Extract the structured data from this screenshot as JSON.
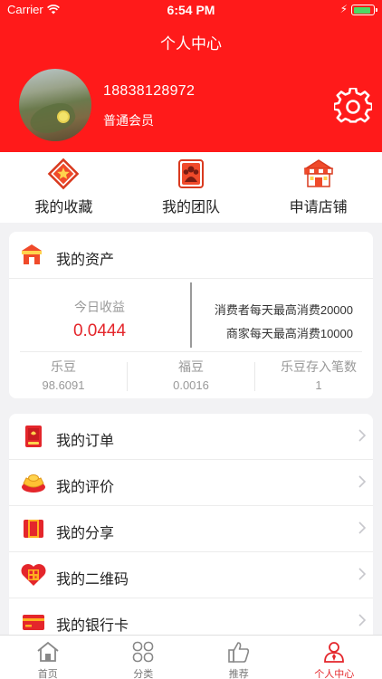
{
  "status_bar": {
    "carrier": "Carrier",
    "time": "6:54 PM",
    "battery_level": 0.9
  },
  "header": {
    "title": "个人中心",
    "phone": "18838128972",
    "member_level": "普通会员"
  },
  "quick_actions": [
    {
      "label": "我的收藏",
      "icon": "favorites-star-icon"
    },
    {
      "label": "我的团队",
      "icon": "team-icon"
    },
    {
      "label": "申请店铺",
      "icon": "shop-icon"
    }
  ],
  "assets": {
    "title": "我的资产",
    "icon": "shop-small-icon",
    "today_income_label": "今日收益",
    "today_income_value": "0.0444",
    "consumer_limit": "消费者每天最高消费20000",
    "merchant_limit": "商家每天最高消费10000",
    "stats": [
      {
        "label": "乐豆",
        "value": "98.6091"
      },
      {
        "label": "福豆",
        "value": "0.0016"
      },
      {
        "label": "乐豆存入笔数",
        "value": "1"
      }
    ]
  },
  "menu": [
    {
      "label": "我的订单",
      "icon": "order-book-icon"
    },
    {
      "label": "我的评价",
      "icon": "gold-ingot-icon"
    },
    {
      "label": "我的分享",
      "icon": "share-envelope-icon"
    },
    {
      "label": "我的二维码",
      "icon": "qr-code-heart-icon"
    },
    {
      "label": "我的银行卡",
      "icon": "bank-card-icon"
    }
  ],
  "tabbar": [
    {
      "label": "首页",
      "icon": "home-icon",
      "active": false
    },
    {
      "label": "分类",
      "icon": "category-icon",
      "active": false
    },
    {
      "label": "推荐",
      "icon": "thumbs-up-icon",
      "active": false
    },
    {
      "label": "个人中心",
      "icon": "profile-icon",
      "active": true
    }
  ],
  "colors": {
    "brand_red": "#ff1a1a",
    "value_red": "#e4262b",
    "background": "#f2f2f4"
  }
}
